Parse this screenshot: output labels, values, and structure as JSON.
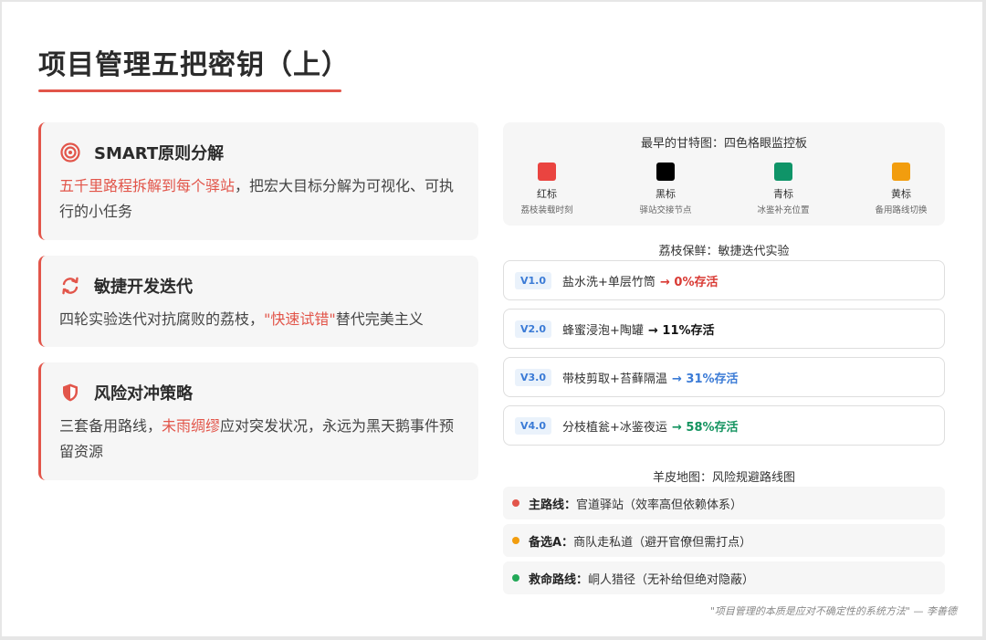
{
  "title": "项目管理五把密钥（上）",
  "cards": [
    {
      "icon": "target-icon",
      "title": "SMART原则分解",
      "body_hl": "五千里路程拆解到每个驿站",
      "body_rest": "，把宏大目标分解为可视化、可执行的小任务"
    },
    {
      "icon": "refresh-icon",
      "title": "敏捷开发迭代",
      "body_pre": "四轮实验迭代对抗腐败的荔枝，",
      "body_hl": "\"快速试错\"",
      "body_post": "替代完美主义"
    },
    {
      "icon": "shield-icon",
      "title": "风险对冲策略",
      "body_pre": "三套备用路线，",
      "body_hl": "未雨绸缪",
      "body_post": "应对突发状况，永远为黑天鹅事件预留资源"
    }
  ],
  "gantt": {
    "title": "最早的甘特图：四色格眼监控板",
    "flags": [
      {
        "name": "红标",
        "desc": "荔枝装载时刻",
        "color": "#ea4440"
      },
      {
        "name": "黑标",
        "desc": "驿站交接节点",
        "color": "#000000"
      },
      {
        "name": "青标",
        "desc": "冰鉴补充位置",
        "color": "#0f9468"
      },
      {
        "name": "黄标",
        "desc": "备用路线切换",
        "color": "#f29d0e"
      }
    ]
  },
  "iteration": {
    "title": "荔枝保鲜：敏捷迭代实验",
    "versions": [
      {
        "badge": "V1.0",
        "text": "盐水洗+单层竹筒",
        "result": "→ 0%存活",
        "color": "#d93a34"
      },
      {
        "badge": "V2.0",
        "text": "蜂蜜浸泡+陶罐",
        "result": "→ 11%存活",
        "color": "#111111"
      },
      {
        "badge": "V3.0",
        "text": "带枝剪取+苔藓隔温",
        "result": "→ 31%存活",
        "color": "#3b7bd6"
      },
      {
        "badge": "V4.0",
        "text": "分枝植瓮+冰鉴夜运",
        "result": "→ 58%存活",
        "color": "#13935f"
      }
    ]
  },
  "routes": {
    "title": "羊皮地图：风险规避路线图",
    "items": [
      {
        "name": "主路线：",
        "desc": "官道驿站（效率高但依赖体系）",
        "color": "#e2554a"
      },
      {
        "name": "备选A：",
        "desc": "商队走私道（避开官僚但需打点）",
        "color": "#f29d0e"
      },
      {
        "name": "救命路线：",
        "desc": "峒人猎径（无补给但绝对隐蔽）",
        "color": "#21a857"
      }
    ]
  },
  "quote": "\"项目管理的本质是应对不确定性的系统方法\" — 李善德"
}
